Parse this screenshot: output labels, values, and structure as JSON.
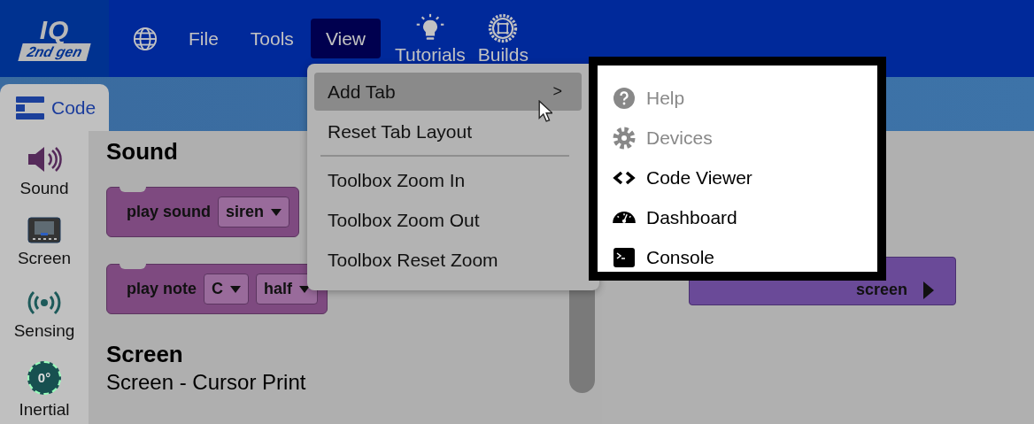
{
  "app_bar": {
    "logo": {
      "line_1": "IQ",
      "line_2": "2nd gen"
    },
    "menus": [
      {
        "label": "File",
        "selected": false
      },
      {
        "label": "Tools",
        "selected": false
      },
      {
        "label": "View",
        "selected": true
      }
    ],
    "buttons": [
      {
        "label": "Tutorials",
        "kind": "bulb"
      },
      {
        "label": "Builds",
        "kind": "gear"
      }
    ]
  },
  "tabs": [
    {
      "label": "Code",
      "selected": true
    }
  ],
  "categories": [
    {
      "label": "Sound",
      "kind": "speaker"
    },
    {
      "label": "Screen",
      "kind": "screen"
    },
    {
      "label": "Sensing",
      "kind": "signal"
    },
    {
      "label": "Inertial",
      "kind": "dial",
      "badge": "0°"
    }
  ],
  "palette": [
    {
      "kind": "heading",
      "text": "Sound"
    },
    {
      "kind": "block",
      "parts": [
        {
          "kind": "text",
          "text": "play sound"
        },
        {
          "kind": "dropdown",
          "text": "siren"
        }
      ]
    },
    {
      "kind": "block",
      "parts": [
        {
          "kind": "text",
          "text": "play note"
        },
        {
          "kind": "dropdown",
          "text": "C"
        },
        {
          "kind": "dropdown",
          "text": "half"
        }
      ]
    },
    {
      "kind": "heading",
      "text": "Screen"
    },
    {
      "kind": "subheading",
      "text": "Screen - Cursor Print"
    }
  ],
  "view_menu": {
    "groups": [
      [
        {
          "label": "Add Tab",
          "arrow": ">",
          "selected": true
        },
        {
          "label": "Reset Tab Layout",
          "selected": false
        }
      ],
      [
        {
          "label": "Toolbox Zoom In",
          "selected": false
        },
        {
          "label": "Toolbox Zoom Out",
          "selected": false
        },
        {
          "label": "Toolbox Reset Zoom",
          "selected": false
        }
      ]
    ]
  },
  "add_tab_menu": {
    "items": [
      {
        "label": "Help",
        "kind": "help",
        "disabled": true
      },
      {
        "label": "Devices",
        "kind": "gear",
        "disabled": true
      },
      {
        "label": "Code Viewer",
        "kind": "code",
        "disabled": false
      },
      {
        "label": "Dashboard",
        "kind": "gauge",
        "disabled": false
      },
      {
        "label": "Console",
        "kind": "console",
        "disabled": false
      }
    ]
  },
  "workspace": {
    "block": {
      "text": "screen"
    }
  }
}
